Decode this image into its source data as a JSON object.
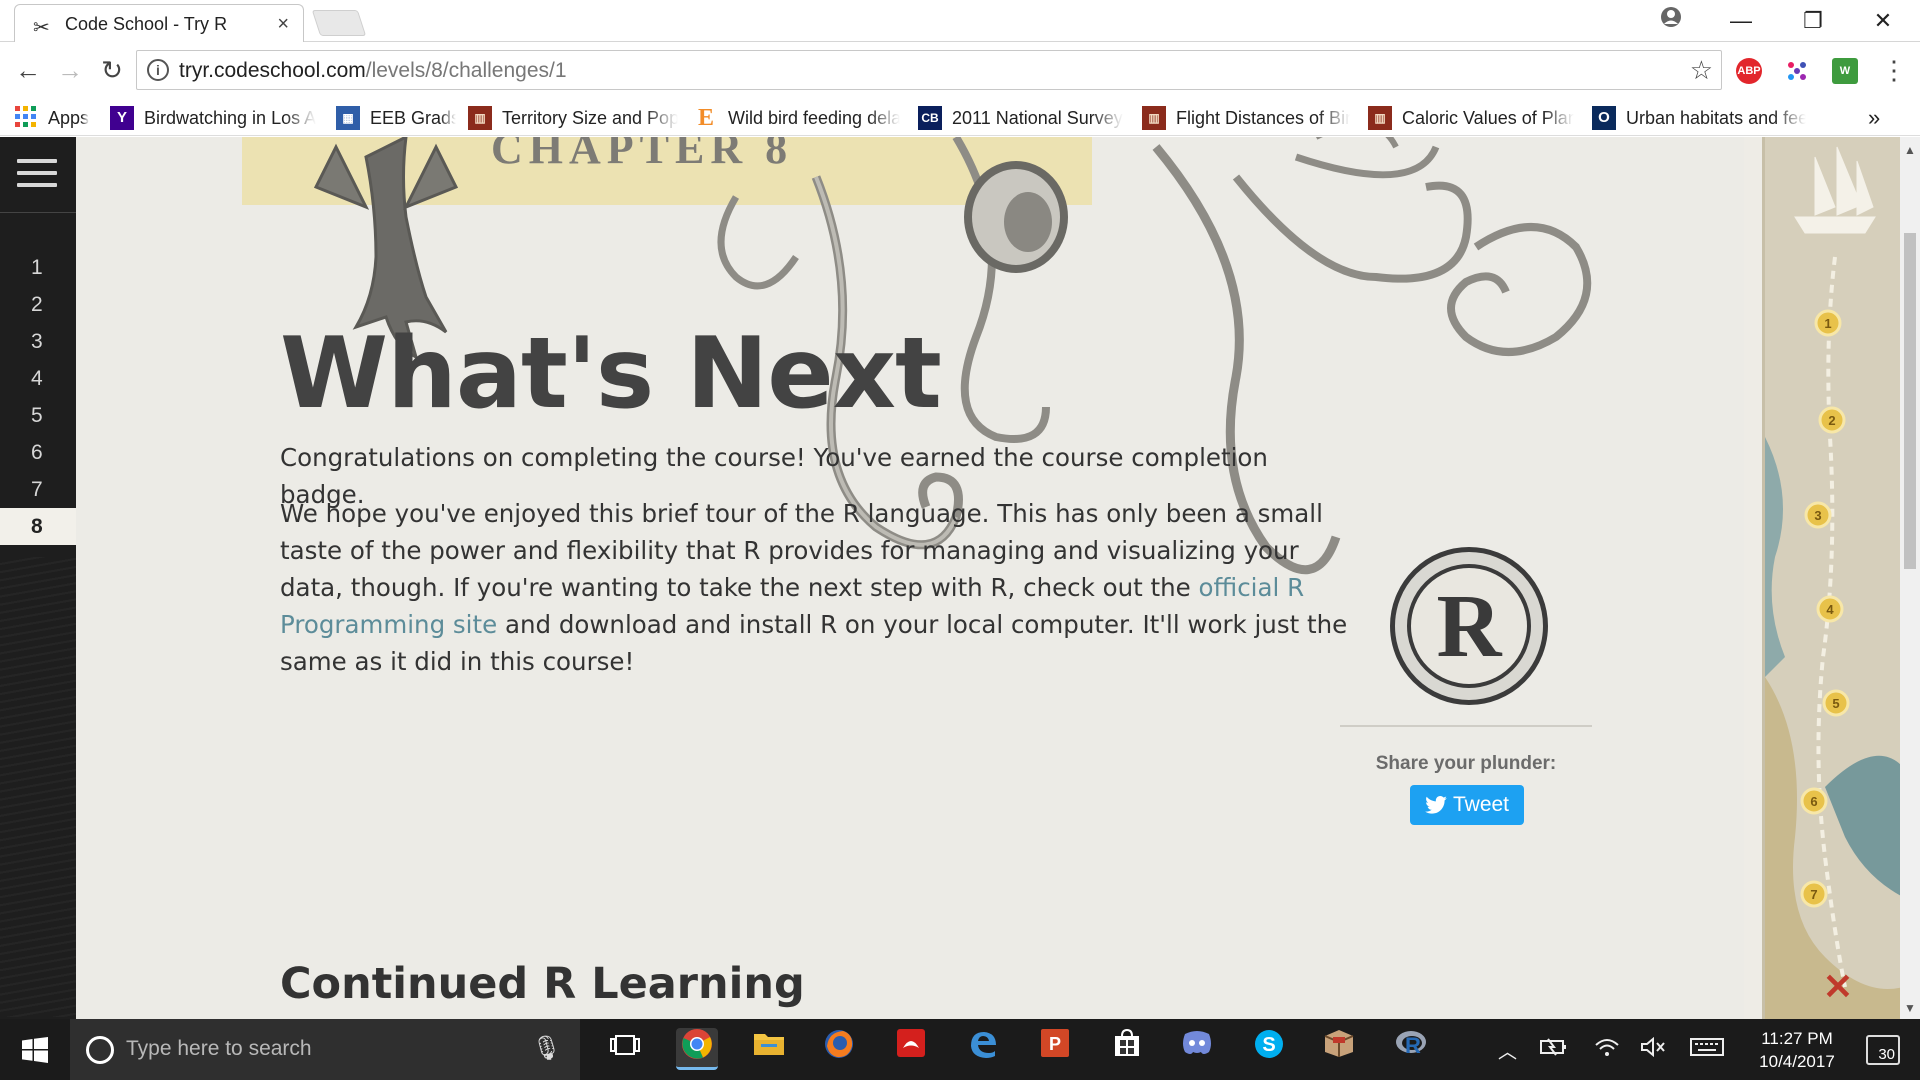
{
  "browser": {
    "tab": {
      "title": "Code School - Try R",
      "close": "×"
    },
    "window_controls": {
      "minimize": "—",
      "restore": "❐",
      "close": "✕"
    },
    "url": {
      "host": "tryr.codeschool.com",
      "path": "/levels/8/challenges/1"
    },
    "extensions": [
      {
        "name": "adblock-plus",
        "label": "ABP",
        "color": "#e2262c"
      }
    ],
    "bookmarks": [
      {
        "label": "Apps",
        "icon": "apps-grid-icon"
      },
      {
        "label": "Birdwatching in Los Angeles",
        "icon": "yahoo-icon"
      },
      {
        "label": "EEB Grads",
        "icon": "calendar-icon"
      },
      {
        "label": "Territory Size and Population",
        "icon": "jstor-icon"
      },
      {
        "label": "Wild bird feeding delays",
        "icon": "elsevier-icon"
      },
      {
        "label": "2011 National Survey",
        "icon": "cb-icon"
      },
      {
        "label": "Flight Distances of Birds",
        "icon": "jstor-icon"
      },
      {
        "label": "Caloric Values of Plants",
        "icon": "jstor-icon"
      },
      {
        "label": "Urban habitats and feeders",
        "icon": "oxford-icon"
      }
    ],
    "bookmarks_overflow": "»"
  },
  "sidebar": {
    "levels": [
      "1",
      "2",
      "3",
      "4",
      "5",
      "6",
      "7",
      "8"
    ],
    "active_level": "8"
  },
  "main": {
    "chapter_label": "CHAPTER 8",
    "heading": "What's Next",
    "paragraph1": "Congratulations on completing the course! You've earned the course completion badge.",
    "paragraph2_before": "We hope you've enjoyed this brief tour of the R language. This has only been a small taste of the power and flexibility that R provides for managing and visualizing your data, though. If you're wanting to take the next step with R, check out the ",
    "paragraph2_link": "official R Programming site",
    "paragraph2_after": " and download and install R on your local computer. It'll work just the same as it did in this course!",
    "subheading": "Continued R Learning",
    "badge_letter": "R",
    "share_label": "Share your plunder:",
    "tweet_label": "Tweet",
    "colors": {
      "link": "#5c8c99",
      "tweet": "#1da1f2",
      "banner": "#ece2b2",
      "heading": "#434343"
    }
  },
  "map": {
    "stops": [
      "1",
      "2",
      "3",
      "4",
      "5",
      "6",
      "7"
    ],
    "end_marker": "✕"
  },
  "taskbar": {
    "search_placeholder": "Type here to search",
    "time": "11:27 PM",
    "date": "10/4/2017",
    "notifications": "30",
    "apps": [
      "task-view",
      "chrome",
      "file-explorer",
      "firefox",
      "acrobat",
      "edge",
      "powerpoint",
      "store",
      "discord",
      "skype",
      "wrapped-app",
      "r-app"
    ]
  }
}
